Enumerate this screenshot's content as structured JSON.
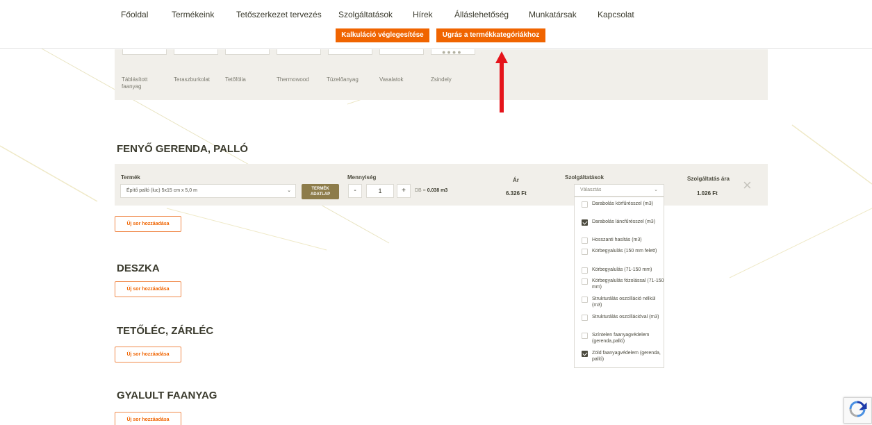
{
  "nav": {
    "items": [
      "Főoldal",
      "Termékeink",
      "Tetőszerkezet tervezés",
      "Szolgáltatások",
      "Hírek",
      "Álláslehetőség",
      "Munkatársak",
      "Kapcsolat"
    ],
    "finalize_label": "Kalkuláció véglegesítése",
    "jump_label": "Ugrás a termékkategóriákhoz"
  },
  "categories": [
    "Táblásított faanyag",
    "Teraszburkolat",
    "Tetőfólia",
    "Thermowood",
    "Tüzelőanyag",
    "Vasalatok",
    "Zsindely"
  ],
  "sections": [
    {
      "title": "FENYŐ GERENDA, PALLÓ",
      "add_row_label": "Új sor hozzáadása"
    },
    {
      "title": "DESZKA",
      "add_row_label": "Új sor hozzáadása"
    },
    {
      "title": "TETŐLÉC, ZÁRLÉC",
      "add_row_label": "Új sor hozzáadása"
    },
    {
      "title": "GYALULT FAANYAG",
      "add_row_label": "Új sor hozzáadása"
    }
  ],
  "product_row": {
    "product_header": "Termék",
    "quantity_header": "Mennyiség",
    "price_header": "Ár",
    "services_header": "Szolgáltatások",
    "service_price_header": "Szolgáltatás ára",
    "selected_product": "Építő palló (luc) 5x15 cm x 5,0 m",
    "datasheet_line1": "TERMÉK",
    "datasheet_line2": "ADATLAP",
    "minus": "-",
    "plus": "+",
    "quantity": "1",
    "db_prefix": "DB = ",
    "volume": "0.038 m3",
    "price": "6.326 Ft",
    "service_price": "1.026 Ft",
    "remove": "×"
  },
  "services": {
    "placeholder": "Választás",
    "options": [
      {
        "label": "Darabolás körfűrésszel (m3)",
        "checked": false
      },
      {
        "label": "Darabolás láncfűrésszel (m3)",
        "checked": true
      },
      {
        "label": "Hosszanti hasítás (m3)",
        "checked": false
      },
      {
        "label": "Körbegyalulás (150 mm felett)",
        "checked": false
      },
      {
        "label": "Körbegyalulás (71-150 mm)",
        "checked": false
      },
      {
        "label": "Körbegyalulás fózolással (71-150 mm)",
        "checked": false
      },
      {
        "label": "Strukturálás oszcilláció nélkül (m3)",
        "checked": false
      },
      {
        "label": "Strukturálás oszcillációval (m3)",
        "checked": false
      },
      {
        "label": "Színtelen faanyagvédelem (gerenda,palló)",
        "checked": false
      },
      {
        "label": "Zöld faanyagvédelem (gerenda, palló)",
        "checked": true
      }
    ]
  },
  "colors": {
    "accent": "#f06400",
    "panel": "#f1efea",
    "datasheet": "#8d7c4a",
    "arrow": "#e5141b"
  }
}
